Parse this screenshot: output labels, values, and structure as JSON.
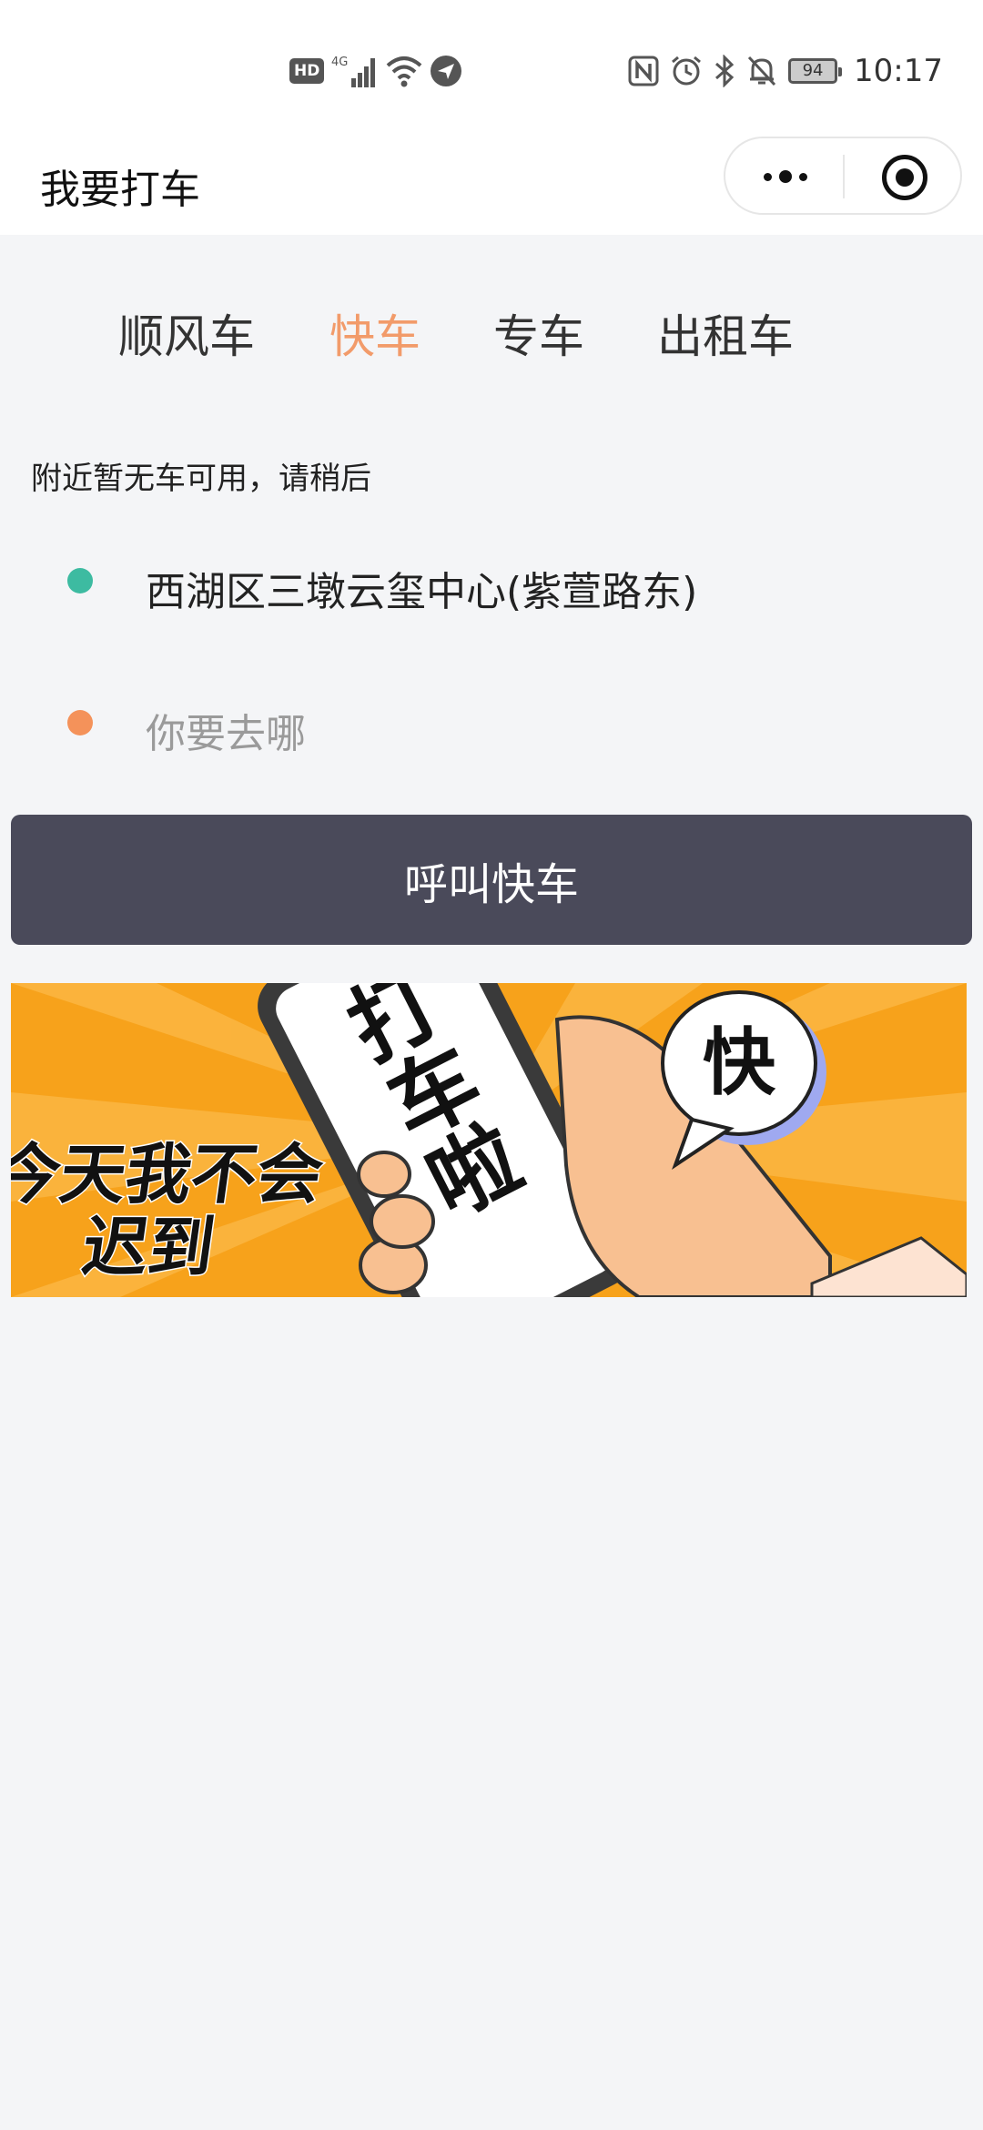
{
  "status_bar": {
    "left_icons": [
      "hd-icon",
      "signal-4g-icon",
      "wifi-icon",
      "location-icon"
    ],
    "hd_label": "HD",
    "right_icons": [
      "nfc-icon",
      "alarm-icon",
      "bluetooth-icon",
      "mute-icon"
    ],
    "battery": "94",
    "time": "10:17"
  },
  "nav": {
    "title": "我要打车",
    "more_icon": "more-dots-icon",
    "close_icon": "close-target-icon"
  },
  "tabs": [
    {
      "label": "顺风车",
      "active": false
    },
    {
      "label": "快车",
      "active": true
    },
    {
      "label": "专车",
      "active": false
    },
    {
      "label": "出租车",
      "active": false
    }
  ],
  "notice": "附近暂无车可用，请稍后",
  "origin": {
    "value": "西湖区三墩云玺中心(紫萱路东)",
    "dot_color": "#3dbba1"
  },
  "destination": {
    "placeholder": "你要去哪",
    "dot_color": "#f4925a"
  },
  "call_button": "呼叫快车",
  "banner": {
    "slogan_line1": "今天我不会",
    "slogan_line2": "迟到",
    "phone_text": "打车啦",
    "bubble_text": "快"
  },
  "colors": {
    "accent": "#f29b6a",
    "button_bg": "#4a4a5a",
    "page_bg": "#f4f5f7"
  }
}
